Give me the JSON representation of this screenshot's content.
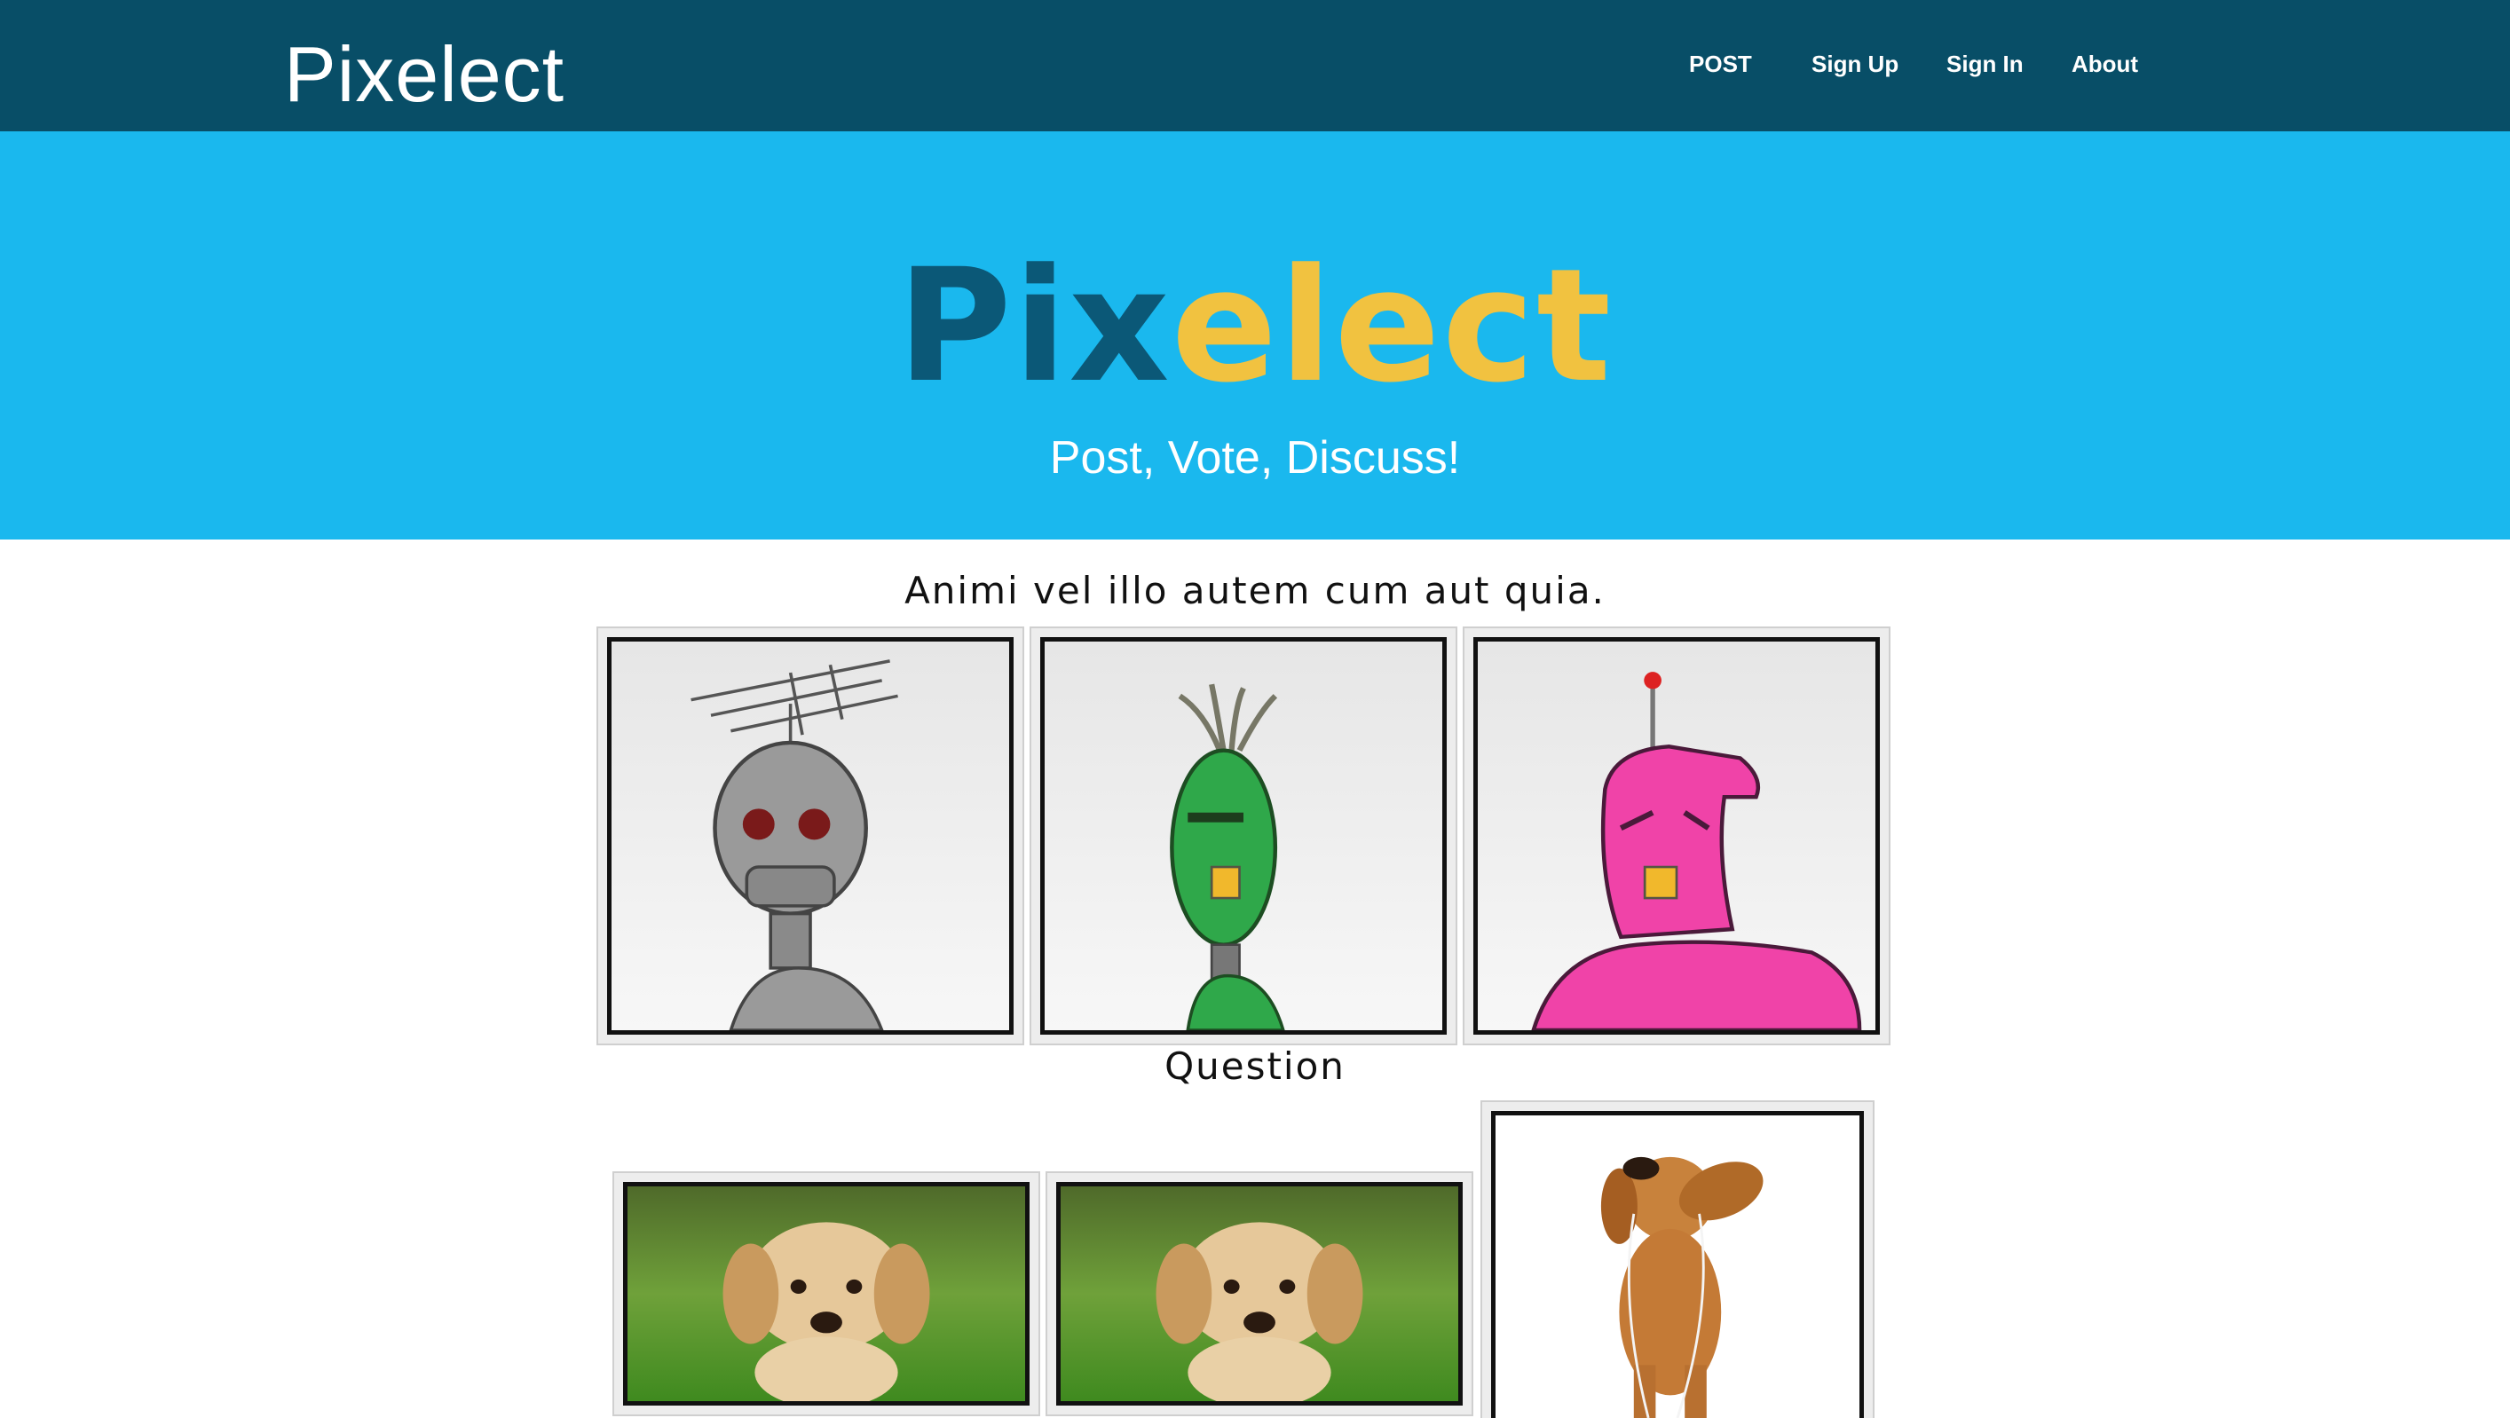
{
  "navbar": {
    "brand": "Pixelect",
    "links": [
      "POST",
      "Sign Up",
      "Sign In",
      "About"
    ]
  },
  "hero": {
    "title_part1": "Pix",
    "title_part2": "elect",
    "subtitle": "Post, Vote, Discuss!"
  },
  "questions": [
    {
      "title": "Animi vel illo autem cum aut quia.",
      "images": [
        "gray-robot",
        "green-robot",
        "pink-robot"
      ]
    },
    {
      "title": "Question",
      "images": [
        "puppy-on-grass",
        "puppy-on-grass",
        "puppy-with-headphones"
      ]
    }
  ],
  "colors": {
    "navbar": "#084e67",
    "hero": "#1ab8ee",
    "brand_dark": "#0b5877",
    "brand_yellow": "#f1c240"
  }
}
